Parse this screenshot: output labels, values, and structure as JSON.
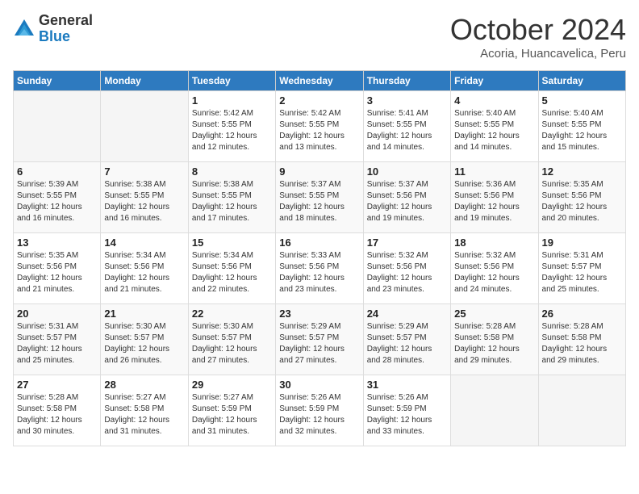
{
  "header": {
    "logo_general": "General",
    "logo_blue": "Blue",
    "month_title": "October 2024",
    "subtitle": "Acoria, Huancavelica, Peru"
  },
  "columns": [
    "Sunday",
    "Monday",
    "Tuesday",
    "Wednesday",
    "Thursday",
    "Friday",
    "Saturday"
  ],
  "weeks": [
    [
      {
        "day": "",
        "lines": []
      },
      {
        "day": "",
        "lines": []
      },
      {
        "day": "1",
        "lines": [
          "Sunrise: 5:42 AM",
          "Sunset: 5:55 PM",
          "Daylight: 12 hours",
          "and 12 minutes."
        ]
      },
      {
        "day": "2",
        "lines": [
          "Sunrise: 5:42 AM",
          "Sunset: 5:55 PM",
          "Daylight: 12 hours",
          "and 13 minutes."
        ]
      },
      {
        "day": "3",
        "lines": [
          "Sunrise: 5:41 AM",
          "Sunset: 5:55 PM",
          "Daylight: 12 hours",
          "and 14 minutes."
        ]
      },
      {
        "day": "4",
        "lines": [
          "Sunrise: 5:40 AM",
          "Sunset: 5:55 PM",
          "Daylight: 12 hours",
          "and 14 minutes."
        ]
      },
      {
        "day": "5",
        "lines": [
          "Sunrise: 5:40 AM",
          "Sunset: 5:55 PM",
          "Daylight: 12 hours",
          "and 15 minutes."
        ]
      }
    ],
    [
      {
        "day": "6",
        "lines": [
          "Sunrise: 5:39 AM",
          "Sunset: 5:55 PM",
          "Daylight: 12 hours",
          "and 16 minutes."
        ]
      },
      {
        "day": "7",
        "lines": [
          "Sunrise: 5:38 AM",
          "Sunset: 5:55 PM",
          "Daylight: 12 hours",
          "and 16 minutes."
        ]
      },
      {
        "day": "8",
        "lines": [
          "Sunrise: 5:38 AM",
          "Sunset: 5:55 PM",
          "Daylight: 12 hours",
          "and 17 minutes."
        ]
      },
      {
        "day": "9",
        "lines": [
          "Sunrise: 5:37 AM",
          "Sunset: 5:55 PM",
          "Daylight: 12 hours",
          "and 18 minutes."
        ]
      },
      {
        "day": "10",
        "lines": [
          "Sunrise: 5:37 AM",
          "Sunset: 5:56 PM",
          "Daylight: 12 hours",
          "and 19 minutes."
        ]
      },
      {
        "day": "11",
        "lines": [
          "Sunrise: 5:36 AM",
          "Sunset: 5:56 PM",
          "Daylight: 12 hours",
          "and 19 minutes."
        ]
      },
      {
        "day": "12",
        "lines": [
          "Sunrise: 5:35 AM",
          "Sunset: 5:56 PM",
          "Daylight: 12 hours",
          "and 20 minutes."
        ]
      }
    ],
    [
      {
        "day": "13",
        "lines": [
          "Sunrise: 5:35 AM",
          "Sunset: 5:56 PM",
          "Daylight: 12 hours",
          "and 21 minutes."
        ]
      },
      {
        "day": "14",
        "lines": [
          "Sunrise: 5:34 AM",
          "Sunset: 5:56 PM",
          "Daylight: 12 hours",
          "and 21 minutes."
        ]
      },
      {
        "day": "15",
        "lines": [
          "Sunrise: 5:34 AM",
          "Sunset: 5:56 PM",
          "Daylight: 12 hours",
          "and 22 minutes."
        ]
      },
      {
        "day": "16",
        "lines": [
          "Sunrise: 5:33 AM",
          "Sunset: 5:56 PM",
          "Daylight: 12 hours",
          "and 23 minutes."
        ]
      },
      {
        "day": "17",
        "lines": [
          "Sunrise: 5:32 AM",
          "Sunset: 5:56 PM",
          "Daylight: 12 hours",
          "and 23 minutes."
        ]
      },
      {
        "day": "18",
        "lines": [
          "Sunrise: 5:32 AM",
          "Sunset: 5:56 PM",
          "Daylight: 12 hours",
          "and 24 minutes."
        ]
      },
      {
        "day": "19",
        "lines": [
          "Sunrise: 5:31 AM",
          "Sunset: 5:57 PM",
          "Daylight: 12 hours",
          "and 25 minutes."
        ]
      }
    ],
    [
      {
        "day": "20",
        "lines": [
          "Sunrise: 5:31 AM",
          "Sunset: 5:57 PM",
          "Daylight: 12 hours",
          "and 25 minutes."
        ]
      },
      {
        "day": "21",
        "lines": [
          "Sunrise: 5:30 AM",
          "Sunset: 5:57 PM",
          "Daylight: 12 hours",
          "and 26 minutes."
        ]
      },
      {
        "day": "22",
        "lines": [
          "Sunrise: 5:30 AM",
          "Sunset: 5:57 PM",
          "Daylight: 12 hours",
          "and 27 minutes."
        ]
      },
      {
        "day": "23",
        "lines": [
          "Sunrise: 5:29 AM",
          "Sunset: 5:57 PM",
          "Daylight: 12 hours",
          "and 27 minutes."
        ]
      },
      {
        "day": "24",
        "lines": [
          "Sunrise: 5:29 AM",
          "Sunset: 5:57 PM",
          "Daylight: 12 hours",
          "and 28 minutes."
        ]
      },
      {
        "day": "25",
        "lines": [
          "Sunrise: 5:28 AM",
          "Sunset: 5:58 PM",
          "Daylight: 12 hours",
          "and 29 minutes."
        ]
      },
      {
        "day": "26",
        "lines": [
          "Sunrise: 5:28 AM",
          "Sunset: 5:58 PM",
          "Daylight: 12 hours",
          "and 29 minutes."
        ]
      }
    ],
    [
      {
        "day": "27",
        "lines": [
          "Sunrise: 5:28 AM",
          "Sunset: 5:58 PM",
          "Daylight: 12 hours",
          "and 30 minutes."
        ]
      },
      {
        "day": "28",
        "lines": [
          "Sunrise: 5:27 AM",
          "Sunset: 5:58 PM",
          "Daylight: 12 hours",
          "and 31 minutes."
        ]
      },
      {
        "day": "29",
        "lines": [
          "Sunrise: 5:27 AM",
          "Sunset: 5:59 PM",
          "Daylight: 12 hours",
          "and 31 minutes."
        ]
      },
      {
        "day": "30",
        "lines": [
          "Sunrise: 5:26 AM",
          "Sunset: 5:59 PM",
          "Daylight: 12 hours",
          "and 32 minutes."
        ]
      },
      {
        "day": "31",
        "lines": [
          "Sunrise: 5:26 AM",
          "Sunset: 5:59 PM",
          "Daylight: 12 hours",
          "and 33 minutes."
        ]
      },
      {
        "day": "",
        "lines": []
      },
      {
        "day": "",
        "lines": []
      }
    ]
  ]
}
